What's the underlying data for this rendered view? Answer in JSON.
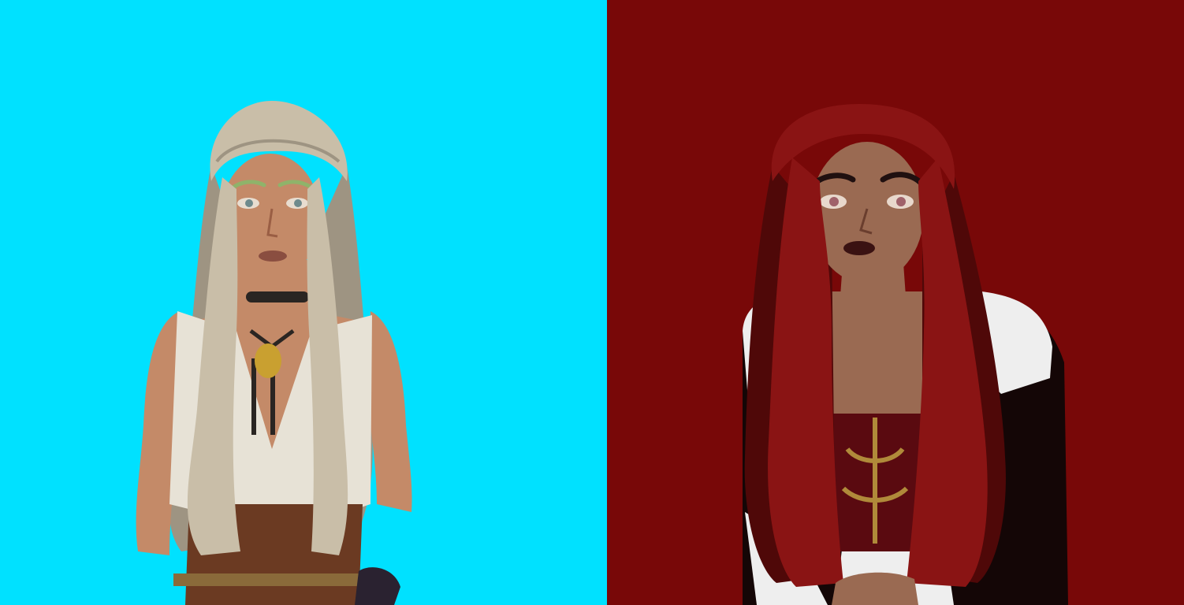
{
  "panels": [
    {
      "id": "left",
      "subject": "character-blonde-braided",
      "colors": {
        "background": "#00e1ff",
        "hair": "#c9bea8",
        "hair_shade": "#9e9482",
        "skin": "#c48a68",
        "skin_shade": "#a36b4e",
        "top": "#e7e2d6",
        "corset": "#6b3a22",
        "choker": "#2a2522",
        "pendant": "#c9a030",
        "eyebrows": "#8fb36a"
      }
    },
    {
      "id": "right",
      "subject": "character-red-haired",
      "colors": {
        "background": "#780808",
        "hair": "#8a1414",
        "hair_shade": "#4f0808",
        "skin": "#9a6a52",
        "skin_shade": "#7a4e3a",
        "fur_collar": "#eeeeee",
        "gown": "#5a0a10",
        "gown_pattern": "#b08a3a",
        "robe": "#140606",
        "earring": "#c41818"
      }
    }
  ]
}
